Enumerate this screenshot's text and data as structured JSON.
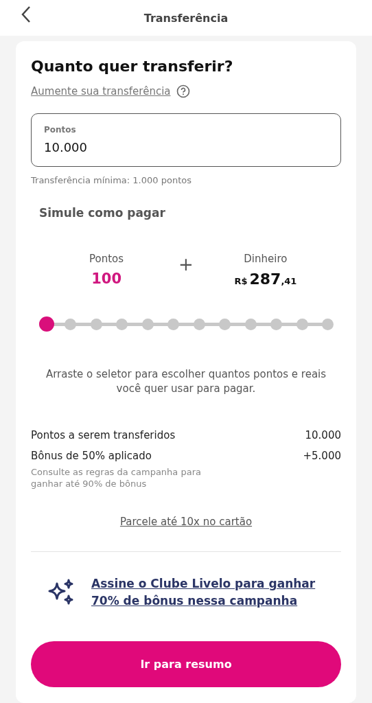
{
  "header": {
    "title": "Transferência"
  },
  "card": {
    "title": "Quanto quer transferir?",
    "increase_link": "Aumente sua transferência",
    "points_field": {
      "label": "Pontos",
      "value": "10.000"
    },
    "minimum_hint": "Transferência mínima: 1.000 pontos",
    "simulate": {
      "title": "Simule como pagar",
      "points": {
        "label": "Pontos",
        "value": "100"
      },
      "plus": "+",
      "money": {
        "label": "Dinheiro",
        "currency": "R$",
        "whole": "287",
        "cents": ",41"
      },
      "slider": {
        "level": 0
      },
      "instruction": "Arraste o seletor para escolher quantos pontos e reais você quer usar para pagar."
    },
    "summary": [
      {
        "label": "Pontos a serem transferidos",
        "value": "10.000"
      },
      {
        "label": "Bônus de 50% aplicado",
        "value": "+5.000"
      }
    ],
    "bonus_note": "Consulte as regras da campanha para ganhar até 90% de bônus",
    "installments_link": "Parcele até 10x no cartão",
    "promo_link": "Assine o Clube Livelo para ganhar 70% de bônus nessa campanha",
    "primary_button": "Ir para resumo"
  }
}
